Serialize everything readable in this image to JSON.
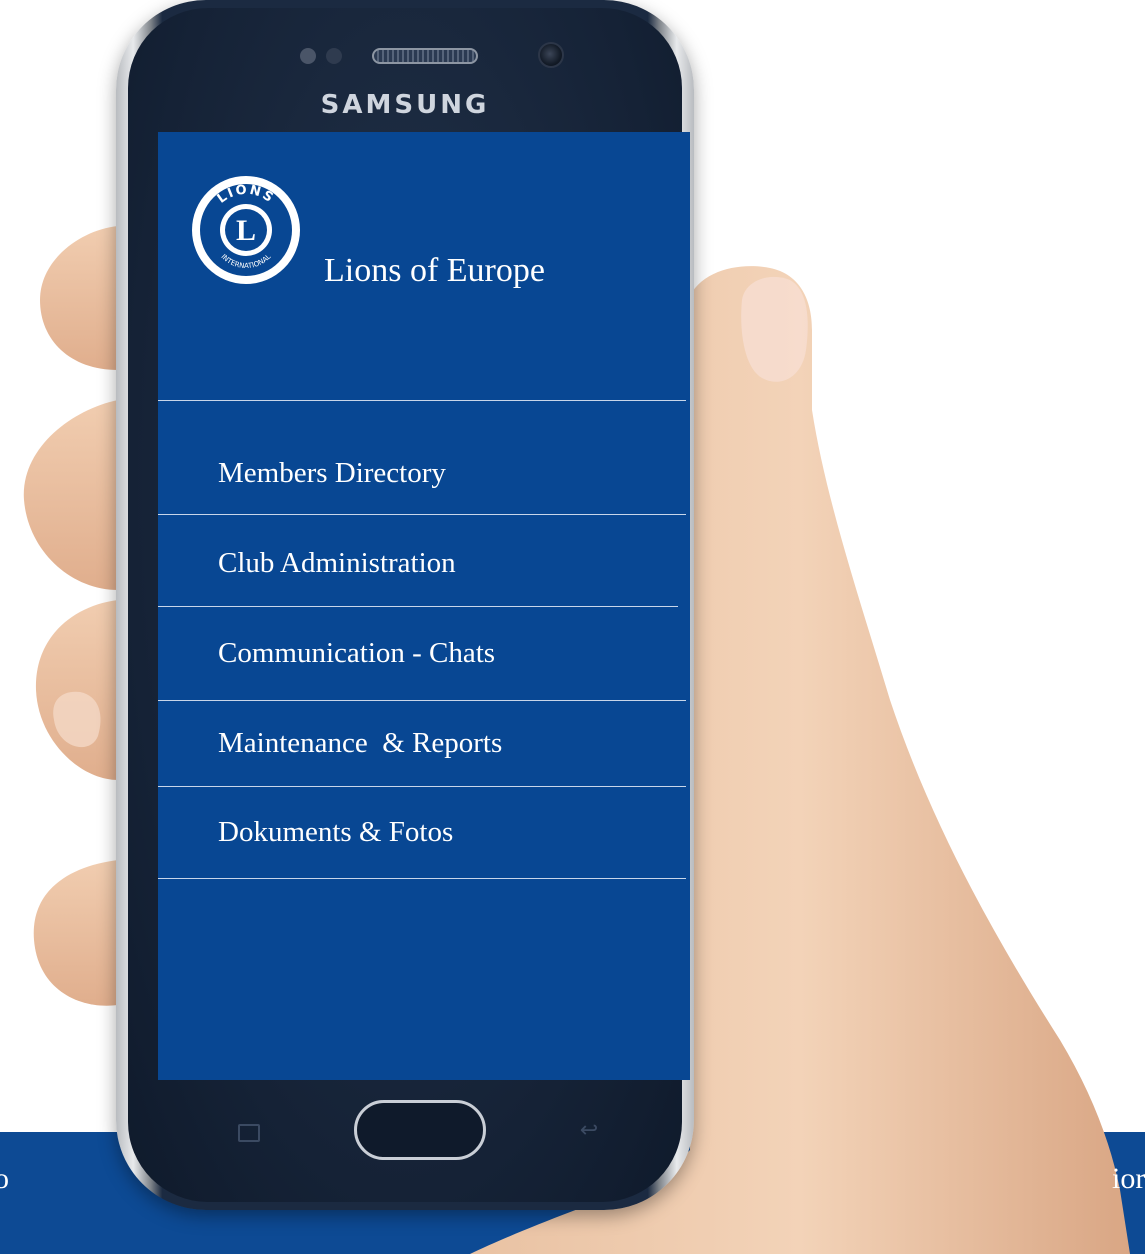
{
  "device": {
    "brand": "SAMSUNG"
  },
  "app": {
    "title": "Lions of  Europe",
    "logo": {
      "icon": "lions-international-logo-icon",
      "text_top": "LIONS",
      "letter": "L",
      "text_bottom": "INTERNATIONAL"
    }
  },
  "menu": {
    "items": [
      {
        "label": "Members Directory"
      },
      {
        "label": "Club Administration"
      },
      {
        "label": "Communication - Chats"
      },
      {
        "label": "Maintenance  & Reports"
      },
      {
        "label": "Dokuments & Fotos"
      }
    ]
  },
  "background": {
    "band_left_text": "o",
    "band_right_text": "ior"
  },
  "colors": {
    "screen_bg": "#084793",
    "band_bg": "#0d4a94",
    "text": "#ffffff",
    "divider": "#c8d6ea"
  }
}
